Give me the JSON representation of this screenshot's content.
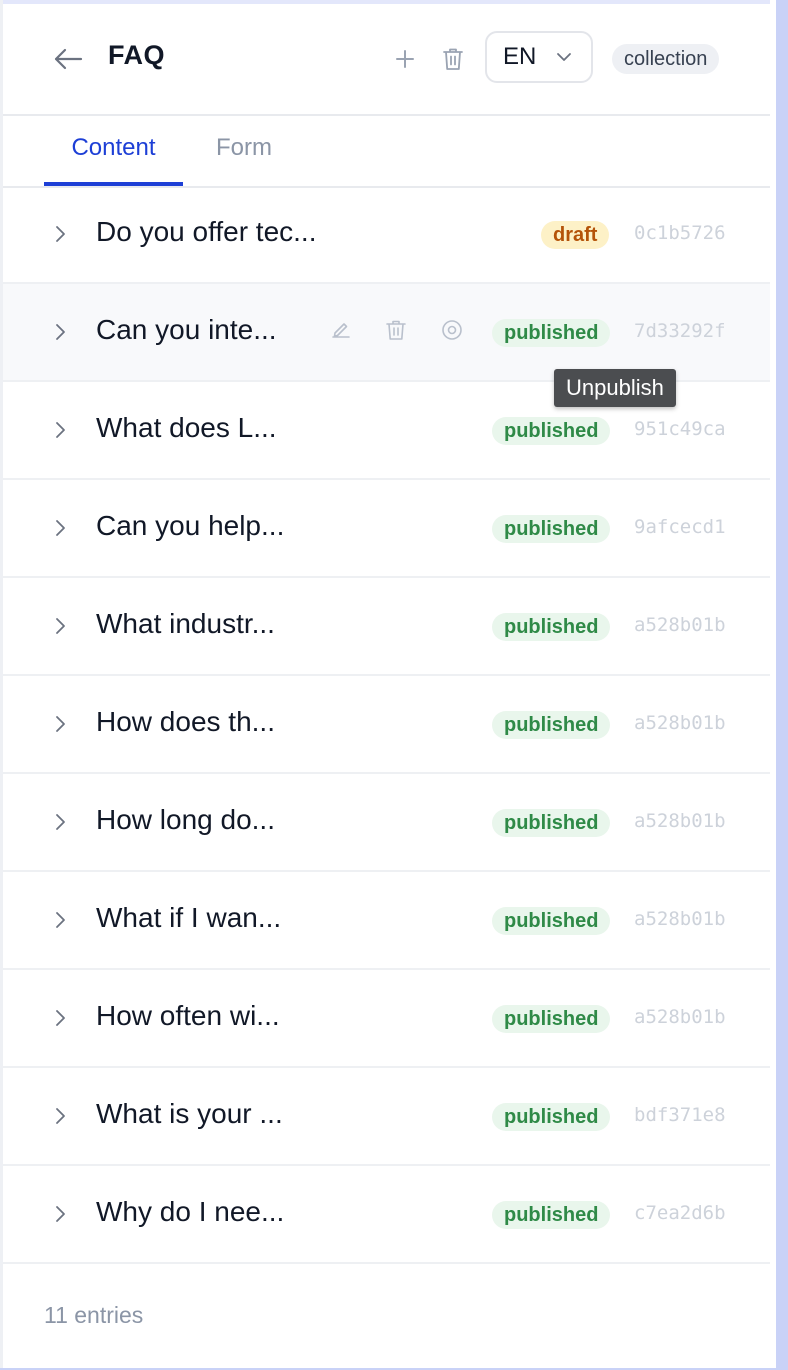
{
  "header": {
    "title": "FAQ",
    "language": "EN",
    "type_badge": "collection"
  },
  "tabs": [
    {
      "label": "Content",
      "active": true
    },
    {
      "label": "Form",
      "active": false
    }
  ],
  "entries": [
    {
      "title": "Do you offer tec...",
      "status": "draft",
      "hash": "0c1b5726"
    },
    {
      "title": "Can you inte...",
      "status": "published",
      "hash": "7d33292f"
    },
    {
      "title": "What does L...",
      "status": "published",
      "hash": "951c49ca"
    },
    {
      "title": "Can you help...",
      "status": "published",
      "hash": "9afcecd1"
    },
    {
      "title": "What industr...",
      "status": "published",
      "hash": "a528b01b"
    },
    {
      "title": "How does th...",
      "status": "published",
      "hash": "a528b01b"
    },
    {
      "title": "How long do...",
      "status": "published",
      "hash": "a528b01b"
    },
    {
      "title": "What if I wan...",
      "status": "published",
      "hash": "a528b01b"
    },
    {
      "title": "How often wi...",
      "status": "published",
      "hash": "a528b01b"
    },
    {
      "title": "What is your ...",
      "status": "published",
      "hash": "bdf371e8"
    },
    {
      "title": "Why do I nee...",
      "status": "published",
      "hash": "c7ea2d6b"
    }
  ],
  "tooltip": "Unpublish",
  "footer": {
    "count": "11 entries"
  },
  "colors": {
    "accent": "#1d3fd6",
    "published_bg": "#e9f6ec",
    "published_fg": "#2f8a47",
    "draft_bg": "#fdf1c7",
    "draft_fg": "#b45309"
  }
}
